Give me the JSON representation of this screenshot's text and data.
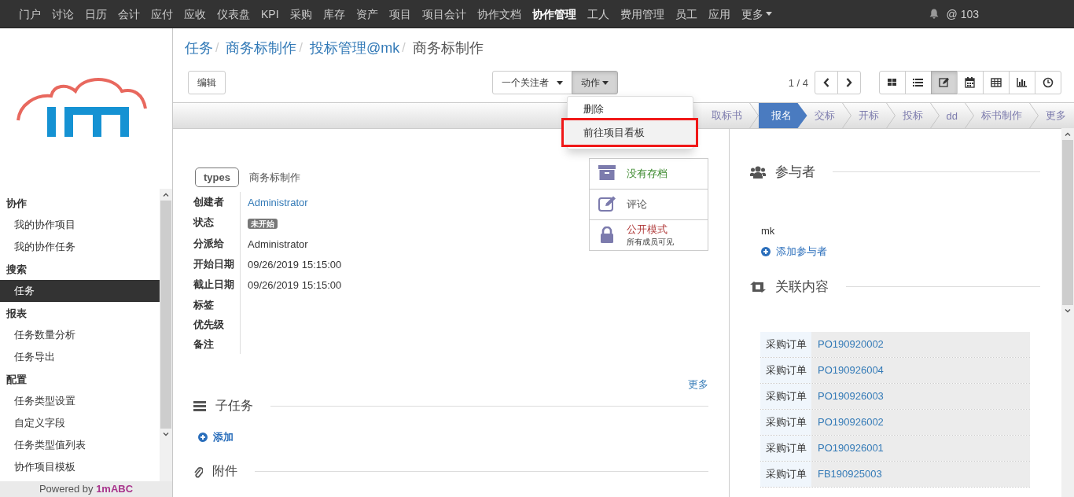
{
  "top_nav": {
    "items": [
      {
        "label": "门户",
        "selected": false
      },
      {
        "label": "讨论",
        "selected": false
      },
      {
        "label": "日历",
        "selected": false
      },
      {
        "label": "会计",
        "selected": false
      },
      {
        "label": "应付",
        "selected": false
      },
      {
        "label": "应收",
        "selected": false
      },
      {
        "label": "仪表盘",
        "selected": false
      },
      {
        "label": "KPI",
        "selected": false
      },
      {
        "label": "采购",
        "selected": false
      },
      {
        "label": "库存",
        "selected": false
      },
      {
        "label": "资产",
        "selected": false
      },
      {
        "label": "项目",
        "selected": false
      },
      {
        "label": "项目会计",
        "selected": false
      },
      {
        "label": "协作文档",
        "selected": false
      },
      {
        "label": "协作管理",
        "selected": true
      },
      {
        "label": "工人",
        "selected": false
      },
      {
        "label": "费用管理",
        "selected": false
      },
      {
        "label": "员工",
        "selected": false
      },
      {
        "label": "应用",
        "selected": false
      }
    ],
    "more": "更多",
    "mentions": "@ 103"
  },
  "sidebar": {
    "sections": [
      {
        "title": "协作",
        "items": [
          {
            "label": "我的协作项目",
            "selected": false
          },
          {
            "label": "我的协作任务",
            "selected": false
          }
        ]
      },
      {
        "title": "搜索",
        "items": [
          {
            "label": "任务",
            "selected": true
          }
        ]
      },
      {
        "title": "报表",
        "items": [
          {
            "label": "任务数量分析",
            "selected": false
          },
          {
            "label": "任务导出",
            "selected": false
          }
        ]
      },
      {
        "title": "配置",
        "items": [
          {
            "label": "任务类型设置",
            "selected": false
          },
          {
            "label": "自定义字段",
            "selected": false
          },
          {
            "label": "任务类型值列表",
            "selected": false
          },
          {
            "label": "协作项目模板",
            "selected": false
          }
        ]
      }
    ],
    "footer_prefix": "Powered by",
    "footer_brand": "1mABC"
  },
  "breadcrumb": [
    {
      "label": "任务",
      "link": true,
      "separator": "/"
    },
    {
      "label": "商务标制作",
      "link": true,
      "separator": "/"
    },
    {
      "label": "投标管理@mk",
      "link": true,
      "separator": "/"
    },
    {
      "label": "商务标制作",
      "link": false
    }
  ],
  "toolbar": {
    "edit": "编辑",
    "follow": "一个关注者",
    "action": {
      "label": "动作",
      "open": true
    },
    "pager": "1 / 4",
    "views": [
      {
        "kind": "kanban",
        "selected": false
      },
      {
        "kind": "list",
        "selected": false
      },
      {
        "kind": "form",
        "selected": true
      },
      {
        "kind": "calendar",
        "selected": false
      },
      {
        "kind": "grid",
        "selected": false
      },
      {
        "kind": "graph",
        "selected": false
      },
      {
        "kind": "timeline",
        "selected": false
      }
    ]
  },
  "action_menu": [
    {
      "label": "删除",
      "highlighted": false
    },
    {
      "label": "前往项目看板",
      "highlighted": true
    }
  ],
  "stages": [
    {
      "label": "取标书",
      "selected": false
    },
    {
      "label": "报名",
      "selected": true
    },
    {
      "label": "交标",
      "selected": false
    },
    {
      "label": "开标",
      "selected": false
    },
    {
      "label": "投标",
      "selected": false
    },
    {
      "label": "dd",
      "selected": false
    },
    {
      "label": "标书制作",
      "selected": false
    },
    {
      "label": "更多",
      "selected": false
    }
  ],
  "form": {
    "type_tag": "types",
    "type_value": "商务标制作",
    "fields": [
      {
        "label": "创建者",
        "kind": "link",
        "value": "Administrator"
      },
      {
        "label": "状态",
        "kind": "badge",
        "value": "未开始"
      },
      {
        "label": "分派给",
        "kind": "text",
        "value": "Administrator"
      },
      {
        "label": "开始日期",
        "kind": "text",
        "value": "09/26/2019 15:15:00"
      },
      {
        "label": "截止日期",
        "kind": "text",
        "value": "09/26/2019 15:15:00"
      },
      {
        "label": "标签",
        "kind": "empty"
      },
      {
        "label": "优先级",
        "kind": "empty"
      },
      {
        "label": "备注",
        "kind": "empty"
      }
    ]
  },
  "smart_buttons": [
    {
      "kind": "archive",
      "label": "没有存档",
      "color": "#3c8a2e"
    },
    {
      "kind": "comment",
      "label": "评论",
      "color": "#555555"
    },
    {
      "kind": "lock",
      "label": "公开模式",
      "sublabel": "所有成员可见",
      "color": "#b03a3a"
    }
  ],
  "more_link": "更多",
  "subtasks": {
    "title": "子任务",
    "add": "添加"
  },
  "attachments": {
    "title": "附件"
  },
  "followers": {
    "title": "参与者",
    "members": [
      "mk"
    ],
    "add": "添加参与者"
  },
  "related": {
    "title": "关联内容",
    "rows": [
      {
        "type": "采购订单",
        "ref": "PO190920002"
      },
      {
        "type": "采购订单",
        "ref": "PO190926004"
      },
      {
        "type": "采购订单",
        "ref": "PO190926003"
      },
      {
        "type": "采购订单",
        "ref": "PO190926002"
      },
      {
        "type": "采购订单",
        "ref": "PO190926001"
      },
      {
        "type": "采购订单",
        "ref": "FB190925003"
      }
    ]
  }
}
